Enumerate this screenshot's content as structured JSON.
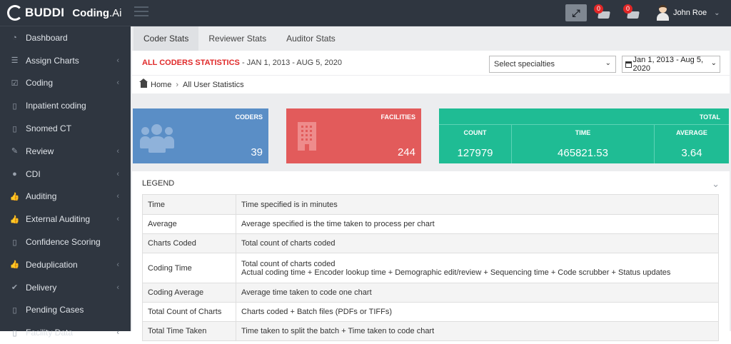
{
  "brand": {
    "name": "BUDDI",
    "product": "Coding",
    "suffix": ".Ai"
  },
  "topbar": {
    "notifications": [
      {
        "icon": "inbox-icon",
        "count": "0"
      },
      {
        "icon": "tasks-icon",
        "count": "0"
      }
    ],
    "user_name": "John Roe"
  },
  "sidebar": {
    "items": [
      {
        "label": "Dashboard",
        "icon": "dashboard-icon",
        "chevron": false
      },
      {
        "label": "Assign Charts",
        "icon": "list-icon",
        "chevron": true
      },
      {
        "label": "Coding",
        "icon": "check-square-icon",
        "chevron": true
      },
      {
        "label": "Inpatient coding",
        "icon": "file-icon",
        "chevron": false
      },
      {
        "label": "Snomed CT",
        "icon": "file-icon",
        "chevron": false
      },
      {
        "label": "Review",
        "icon": "edit-icon",
        "chevron": true
      },
      {
        "label": "CDI",
        "icon": "info-circle-icon",
        "chevron": true
      },
      {
        "label": "Auditing",
        "icon": "thumbs-up-icon",
        "chevron": true
      },
      {
        "label": "External Auditing",
        "icon": "thumbs-up-icon",
        "chevron": true
      },
      {
        "label": "Confidence Scoring",
        "icon": "file-icon",
        "chevron": false
      },
      {
        "label": "Deduplication",
        "icon": "thumbs-up-icon",
        "chevron": true
      },
      {
        "label": "Delivery",
        "icon": "check-circle-icon",
        "chevron": true
      },
      {
        "label": "Pending Cases",
        "icon": "file-icon",
        "chevron": false
      },
      {
        "label": "Facility Data",
        "icon": "file-icon",
        "chevron": true
      }
    ]
  },
  "tabs": [
    {
      "label": "Coder Stats",
      "active": true
    },
    {
      "label": "Reviewer Stats",
      "active": false
    },
    {
      "label": "Auditor Stats",
      "active": false
    }
  ],
  "header": {
    "title_highlight": "ALL CODERS STATISTICS",
    "title_rest": " - JAN 1, 2013 - AUG 5, 2020",
    "specialty_select": "Select specialties",
    "date_range": "Jan 1, 2013 - Aug 5, 2020"
  },
  "breadcrumb": {
    "home": "Home",
    "current": "All User Statistics"
  },
  "cards": {
    "coders": {
      "title": "CODERS",
      "value": "39"
    },
    "facilities": {
      "title": "FACILITIES",
      "value": "244"
    },
    "total": {
      "title": "TOTAL",
      "count_label": "COUNT",
      "count_value": "127979",
      "time_label": "TIME",
      "time_value": "465821.53",
      "average_label": "AVERAGE",
      "average_value": "3.64"
    }
  },
  "legend": {
    "title": "LEGEND",
    "rows": [
      {
        "term": "Time",
        "desc": "Time specified is in minutes",
        "desc2": ""
      },
      {
        "term": "Average",
        "desc": "Average specified is the time taken to process per chart",
        "desc2": ""
      },
      {
        "term": "Charts Coded",
        "desc": "Total count of charts coded",
        "desc2": ""
      },
      {
        "term": "Coding Time",
        "desc": "Total count of charts coded",
        "desc2": "Actual coding time + Encoder lookup time + Demographic edit/review + Sequencing time + Code scrubber + Status updates"
      },
      {
        "term": "Coding Average",
        "desc": "Average time taken to code one chart",
        "desc2": ""
      },
      {
        "term": "Total Count of Charts",
        "desc": "Charts coded + Batch files (PDFs or TIFFs)",
        "desc2": ""
      },
      {
        "term": "Total Time Taken",
        "desc": "Time taken to split the batch + Time taken to code chart",
        "desc2": ""
      }
    ]
  }
}
